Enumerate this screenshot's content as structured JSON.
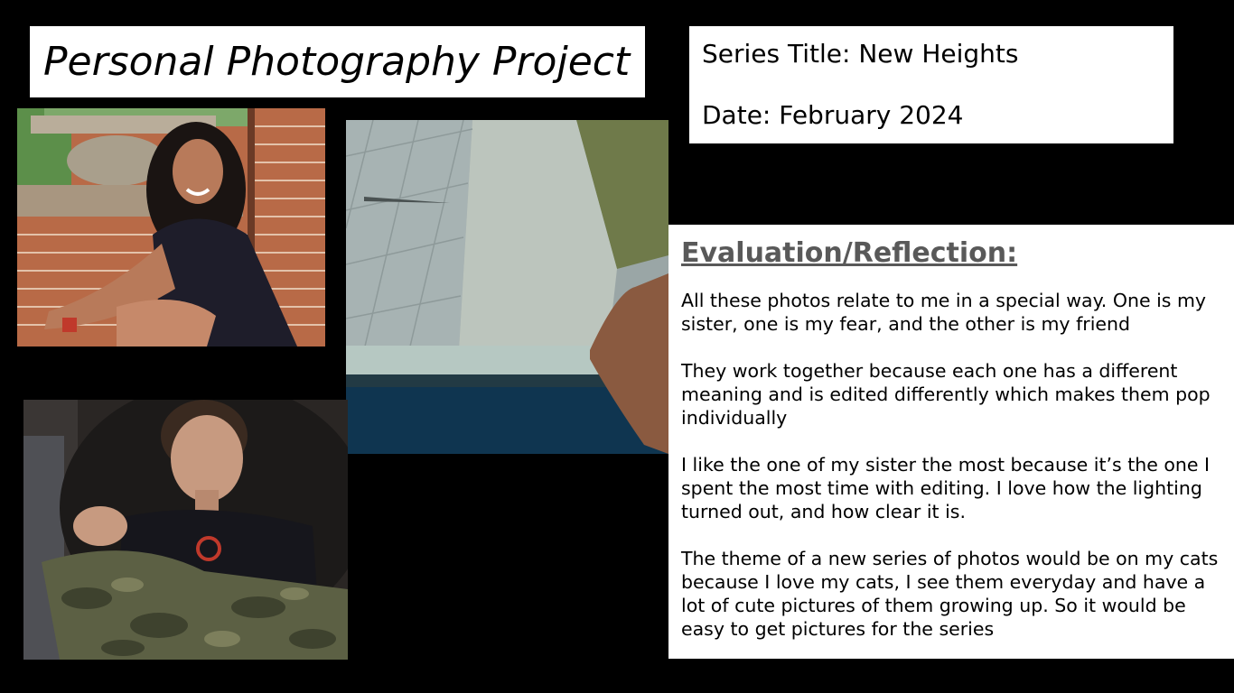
{
  "title": "Personal Photography Project",
  "series_info": {
    "series_title": "Series Title: New Heights",
    "date": "Date: February 2024"
  },
  "reflection": {
    "heading": "Evaluation/Reflection:",
    "paragraphs": [
      "All these photos relate to me in a special way. One is my sister, one is my fear, and the other is my friend",
      "They work together because each one has a different meaning and is edited differently which makes them pop individually",
      "I like the one of my sister the most because it’s the one I spent the most time with editing. I love how the lighting turned out, and how clear it is.",
      "The theme of a new series of photos would be on my cats because I love my cats, I see them everyday and have a lot of cute pictures of them growing up. So it would be easy to get pictures for the series"
    ]
  },
  "colors": {
    "background": "#000000",
    "panel": "#ffffff",
    "heading": "#595959"
  }
}
